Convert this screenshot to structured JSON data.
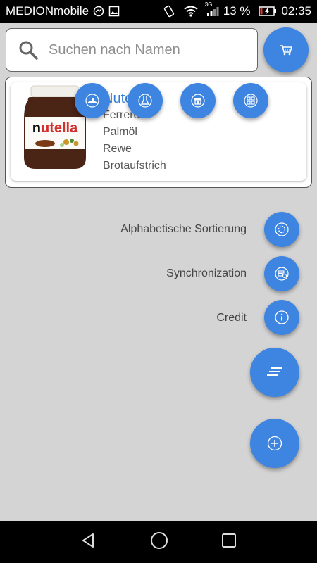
{
  "status_bar": {
    "carrier": "MEDIONmobile",
    "network": "3G",
    "battery": "13 %",
    "time": "02:35"
  },
  "search": {
    "placeholder": "Suchen nach Namen"
  },
  "product": {
    "name": "Nutella",
    "brand": "Ferrero",
    "ingredient": "Palmöl",
    "store": "Rewe",
    "category": "Brotaufstrich"
  },
  "speed_dial": {
    "items": [
      {
        "label": "Alphabetische Sortierung",
        "icon": "sort-icon"
      },
      {
        "label": "Synchronization",
        "icon": "sync-icon"
      },
      {
        "label": "Credit",
        "icon": "info-icon"
      }
    ]
  },
  "colors": {
    "accent": "#3d85e0",
    "link": "#2f7fd8",
    "background": "#d4d4d4"
  }
}
